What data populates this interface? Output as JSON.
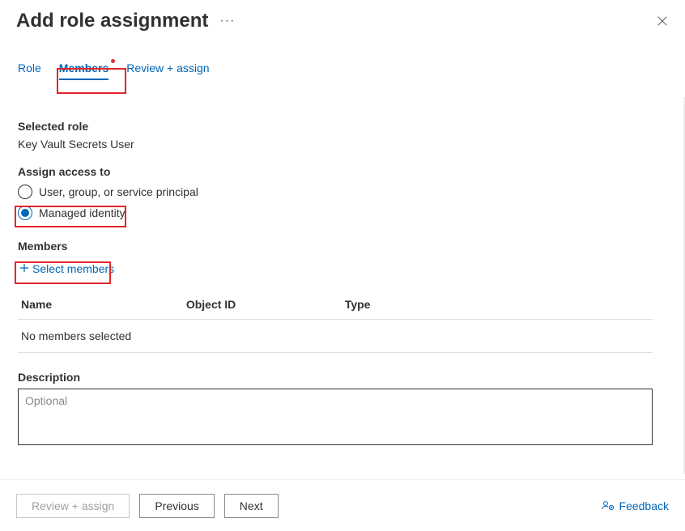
{
  "header": {
    "title": "Add role assignment",
    "more": "···"
  },
  "tabs": {
    "role": "Role",
    "members": "Members",
    "review": "Review + assign",
    "active": "members"
  },
  "selected_role": {
    "label": "Selected role",
    "value": "Key Vault Secrets User"
  },
  "assign_access": {
    "label": "Assign access to",
    "options": {
      "user_group": "User, group, or service principal",
      "managed_identity": "Managed identity"
    },
    "selected": "managed_identity"
  },
  "members": {
    "label": "Members",
    "select_label": "Select members",
    "columns": {
      "name": "Name",
      "object_id": "Object ID",
      "type": "Type"
    },
    "empty": "No members selected"
  },
  "description": {
    "label": "Description",
    "placeholder": "Optional",
    "value": ""
  },
  "footer": {
    "review": "Review + assign",
    "previous": "Previous",
    "next": "Next",
    "feedback": "Feedback"
  }
}
